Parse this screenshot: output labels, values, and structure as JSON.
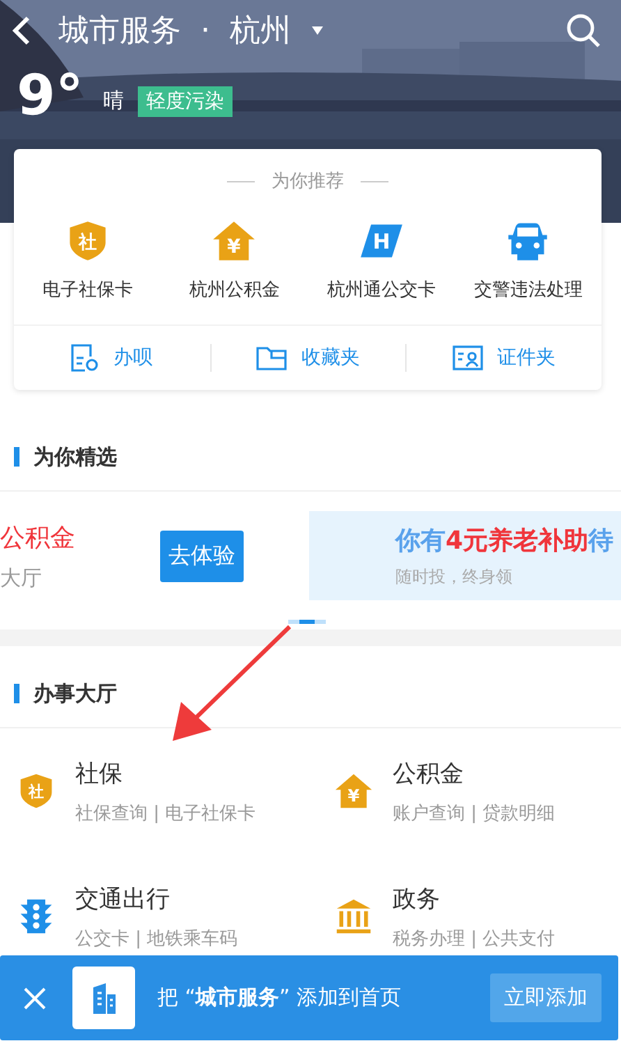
{
  "header": {
    "title": "城市服务",
    "separator": "·",
    "city": "杭州"
  },
  "weather": {
    "temperature": "9°",
    "condition": "晴",
    "air_quality": "轻度污染"
  },
  "recommend": {
    "title": "为你推荐",
    "items": [
      {
        "label": "电子社保卡",
        "kind": "shield",
        "glyph": "社"
      },
      {
        "label": "杭州公积金",
        "kind": "house",
        "glyph": "¥"
      },
      {
        "label": "杭州通公交卡",
        "kind": "card",
        "glyph": "H"
      },
      {
        "label": "交警违法处理",
        "kind": "car"
      }
    ],
    "links": [
      {
        "label": "办呗",
        "kind": "form"
      },
      {
        "label": "收藏夹",
        "kind": "folder"
      },
      {
        "label": "证件夹",
        "kind": "idcard"
      }
    ]
  },
  "featured": {
    "title": "为你精选",
    "slide_left": {
      "title": "公积金",
      "subtitle": "大厅",
      "button": "去体验"
    },
    "slide_right": {
      "headline": [
        {
          "text": "你有",
          "accent": false
        },
        {
          "text": "4元养老补助",
          "accent": true
        },
        {
          "text": "待",
          "accent": false
        }
      ],
      "subtitle": "随时投，终身领"
    },
    "pages": [
      {
        "selected": false
      },
      {
        "selected": true
      },
      {
        "selected": false
      }
    ]
  },
  "hall": {
    "title": "办事大厅",
    "services": [
      {
        "name": "社保",
        "links": "社保查询 | 电子社保卡",
        "kind": "shield",
        "glyph": "社"
      },
      {
        "name": "公积金",
        "links": "账户查询 | 贷款明细",
        "kind": "house",
        "glyph": "¥"
      },
      {
        "name": "交通出行",
        "links": "公交卡 | 地铁乘车码",
        "kind": "traffic"
      },
      {
        "name": "政务",
        "links": "税务办理 | 公共支付",
        "kind": "bank"
      }
    ]
  },
  "banner": {
    "text": "把 “**城市服务**” 添加到首页",
    "button": "立即添加"
  }
}
